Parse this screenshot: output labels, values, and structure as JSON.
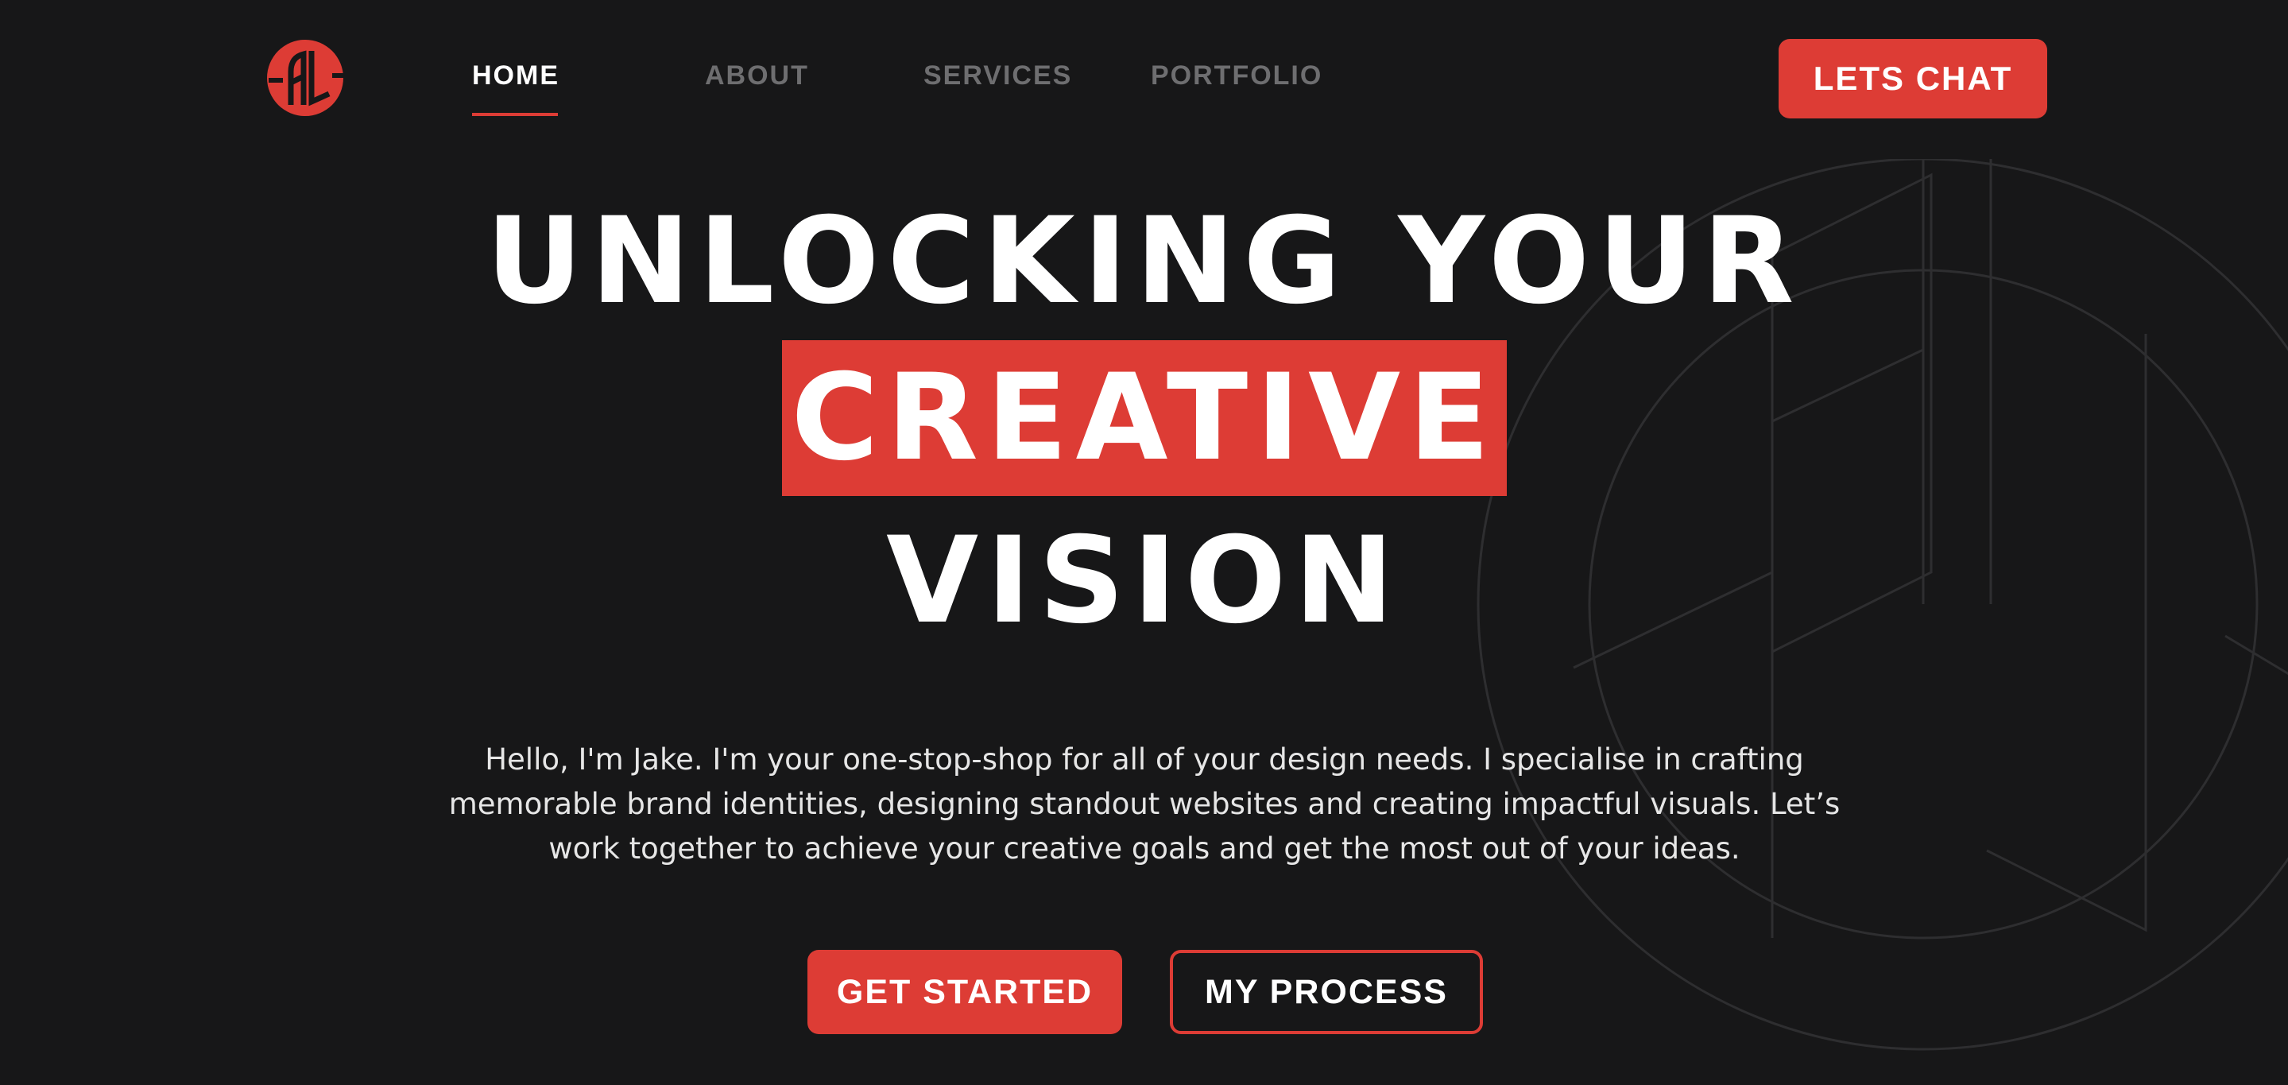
{
  "brand": {
    "logo_icon": "al-monogram-logo-icon",
    "accent_color": "#dd3c35",
    "background_color": "#171718"
  },
  "nav": {
    "items": [
      {
        "label": "HOME",
        "active": true
      },
      {
        "label": "ABOUT",
        "active": false
      },
      {
        "label": "SERVICES",
        "active": false
      },
      {
        "label": "PORTFOLIO",
        "active": false
      }
    ],
    "cta_label": "LETS CHAT"
  },
  "hero": {
    "line1": "UNLOCKING YOUR",
    "highlight": "CREATIVE",
    "line3": "VISION",
    "intro_lines": [
      "Hello, I'm Jake. I'm your one-stop-shop for all of your design needs. I specialise in crafting",
      "memorable brand identities, designing standout websites and creating impactful visuals. Let’s",
      "work together to achieve your creative goals and get the most out of your ideas."
    ],
    "primary_button": "GET STARTED",
    "secondary_button": "MY PROCESS"
  }
}
